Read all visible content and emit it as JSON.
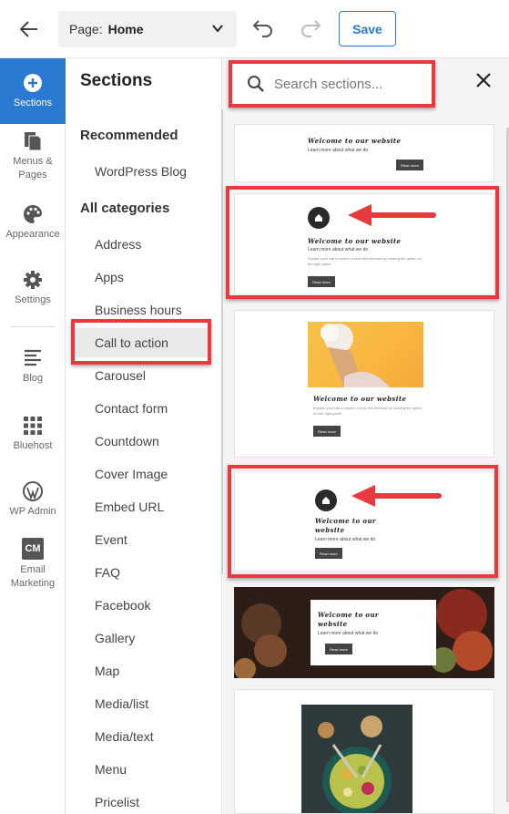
{
  "topbar": {
    "page_label": "Page:",
    "page_value": "Home",
    "save_label": "Save"
  },
  "rail": {
    "items": [
      {
        "label": "Sections",
        "icon": "plus-circle-icon"
      },
      {
        "label": "Menus & Pages",
        "icon": "pages-icon"
      },
      {
        "label": "Appearance",
        "icon": "palette-icon"
      },
      {
        "label": "Settings",
        "icon": "gear-icon"
      },
      {
        "label": "Blog",
        "icon": "blog-icon"
      },
      {
        "label": "Bluehost",
        "icon": "grid-icon"
      },
      {
        "label": "WP Admin",
        "icon": "wordpress-icon"
      },
      {
        "label": "Email Marketing",
        "icon": "cm-icon",
        "badge": "CM"
      }
    ],
    "accent": "#2a7ad1"
  },
  "sections": {
    "title": "Sections",
    "recommended_heading": "Recommended",
    "recommended": [
      "WordPress Blog"
    ],
    "all_heading": "All categories",
    "categories": [
      "Address",
      "Apps",
      "Business hours",
      "Call to action",
      "Carousel",
      "Contact form",
      "Countdown",
      "Cover Image",
      "Embed URL",
      "Event",
      "FAQ",
      "Facebook",
      "Gallery",
      "Map",
      "Media/list",
      "Media/text",
      "Menu",
      "Pricelist"
    ],
    "selected": "Call to action"
  },
  "search": {
    "placeholder": "Search sections..."
  },
  "thumbs": {
    "title": "Welcome to our website",
    "sub": "Learn more about what we do",
    "small": "Explain your call to action or hide this element by clicking the option on the right panel",
    "button": "Read more"
  },
  "annotation_color": "#e8393f"
}
